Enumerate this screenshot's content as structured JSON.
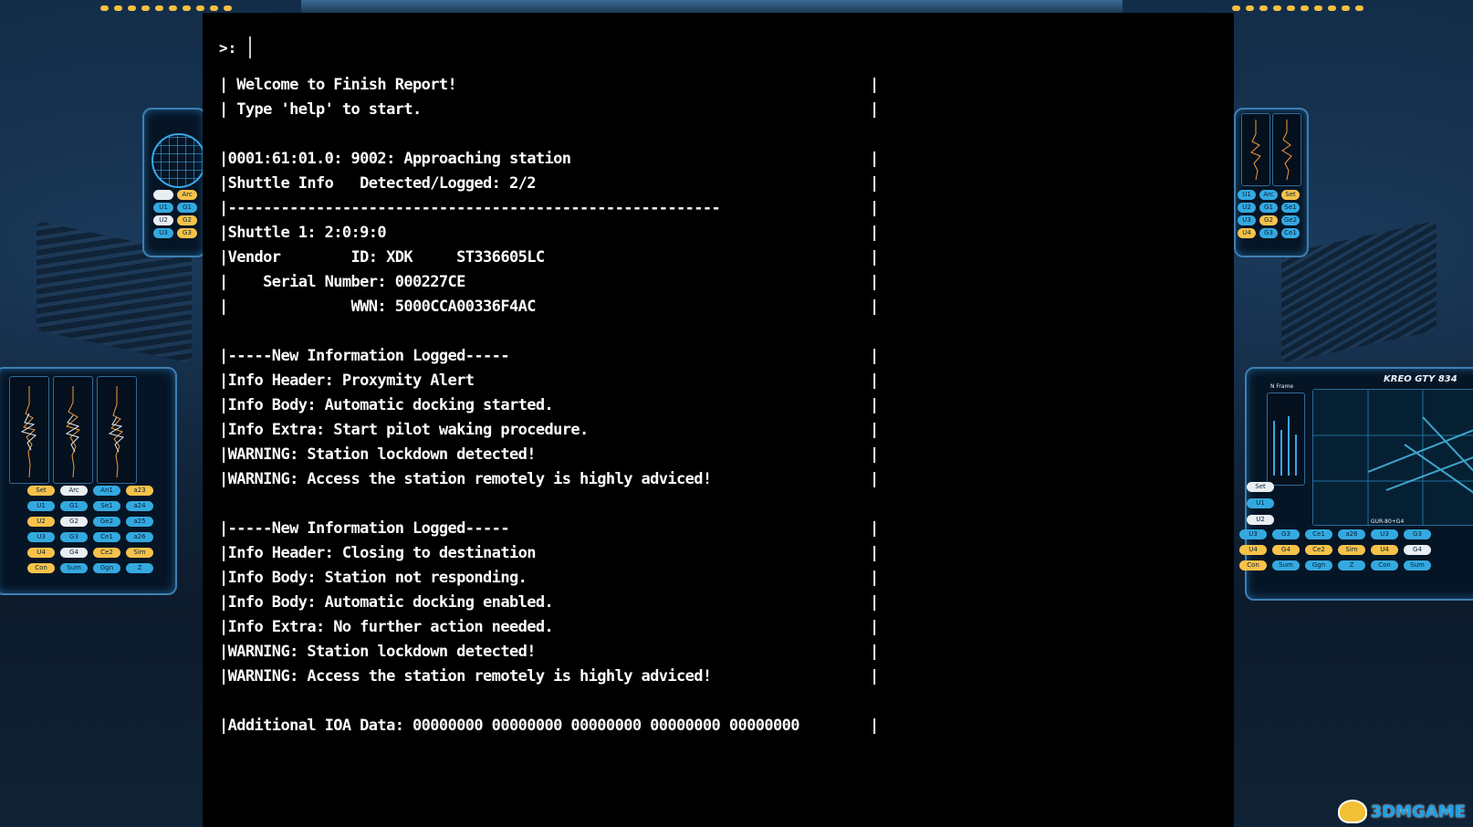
{
  "terminal": {
    "prompt": ">:",
    "lines": [
      {
        "text": "| Welcome to Finish Report!",
        "bar": true
      },
      {
        "text": "| Type 'help' to start.",
        "bar": true
      },
      {
        "text": "",
        "bar": false
      },
      {
        "text": "|0001:61:01.0: 9002: Approaching station",
        "bar": true
      },
      {
        "text": "|Shuttle Info   Detected/Logged: 2/2",
        "bar": true
      },
      {
        "text": "|--------------------------------------------------------",
        "bar": true
      },
      {
        "text": "|Shuttle 1: 2:0:9:0",
        "bar": true
      },
      {
        "text": "|Vendor        ID: XDK     ST336605LC",
        "bar": true
      },
      {
        "text": "|    Serial Number: 000227CE",
        "bar": true
      },
      {
        "text": "|              WWN: 5000CCA00336F4AC",
        "bar": true
      },
      {
        "text": "",
        "bar": false
      },
      {
        "text": "|-----New Information Logged-----",
        "bar": true
      },
      {
        "text": "|Info Header: Proxymity Alert",
        "bar": true
      },
      {
        "text": "|Info Body: Automatic docking started.",
        "bar": true
      },
      {
        "text": "|Info Extra: Start pilot waking procedure.",
        "bar": true
      },
      {
        "text": "|WARNING: Station lockdown detected!",
        "bar": true
      },
      {
        "text": "|WARNING: Access the station remotely is highly adviced!",
        "bar": true
      },
      {
        "text": "",
        "bar": false
      },
      {
        "text": "|-----New Information Logged-----",
        "bar": true
      },
      {
        "text": "|Info Header: Closing to destination",
        "bar": true
      },
      {
        "text": "|Info Body: Station not responding.",
        "bar": true
      },
      {
        "text": "|Info Body: Automatic docking enabled.",
        "bar": true
      },
      {
        "text": "|Info Extra: No further action needed.",
        "bar": true
      },
      {
        "text": "|WARNING: Station lockdown detected!",
        "bar": true
      },
      {
        "text": "|WARNING: Access the station remotely is highly adviced!",
        "bar": true
      },
      {
        "text": "",
        "bar": false
      },
      {
        "text": "|Additional IOA Data: 00000000 00000000 00000000 00000000 00000000",
        "bar": true
      }
    ]
  },
  "left_console": {
    "chips": [
      {
        "label": "Set",
        "color": "y"
      },
      {
        "label": "Arc",
        "color": "w"
      },
      {
        "label": "An1",
        "color": "b"
      },
      {
        "label": "a23",
        "color": "y"
      },
      {
        "label": "U1",
        "color": "b"
      },
      {
        "label": "G1",
        "color": "b"
      },
      {
        "label": "Se1",
        "color": "b"
      },
      {
        "label": "a24",
        "color": "b"
      },
      {
        "label": "U2",
        "color": "y"
      },
      {
        "label": "G2",
        "color": "w"
      },
      {
        "label": "Ge2",
        "color": "b"
      },
      {
        "label": "a25",
        "color": "b"
      },
      {
        "label": "U3",
        "color": "b"
      },
      {
        "label": "G3",
        "color": "b"
      },
      {
        "label": "Ce1",
        "color": "b"
      },
      {
        "label": "a26",
        "color": "b"
      },
      {
        "label": "U4",
        "color": "y"
      },
      {
        "label": "G4",
        "color": "w"
      },
      {
        "label": "Ce2",
        "color": "y"
      },
      {
        "label": "Sim",
        "color": "y"
      },
      {
        "label": "Con",
        "color": "y"
      },
      {
        "label": "Sum",
        "color": "b"
      },
      {
        "label": "Ggn",
        "color": "b"
      },
      {
        "label": "Z",
        "color": "b"
      }
    ],
    "upper_chips": [
      {
        "label": "",
        "color": "w"
      },
      {
        "label": "Arc",
        "color": "y"
      },
      {
        "label": "U1",
        "color": "b"
      },
      {
        "label": "G1",
        "color": "b"
      },
      {
        "label": "U2",
        "color": "w"
      },
      {
        "label": "G2",
        "color": "y"
      },
      {
        "label": "U3",
        "color": "b"
      },
      {
        "label": "G3",
        "color": "y"
      }
    ]
  },
  "right_console": {
    "title": "KREO GTY 834",
    "frame_label": "N Frame",
    "bottom_label": "GUR-80+G4",
    "side_chips": [
      {
        "label": "Set",
        "color": "w"
      },
      {
        "label": "U1",
        "color": "b"
      },
      {
        "label": "U2",
        "color": "w"
      }
    ],
    "chips": [
      {
        "label": "U3",
        "color": "b"
      },
      {
        "label": "G3",
        "color": "b"
      },
      {
        "label": "Ce1",
        "color": "b"
      },
      {
        "label": "a26",
        "color": "b"
      },
      {
        "label": "U3",
        "color": "b"
      },
      {
        "label": "G3",
        "color": "b"
      },
      {
        "label": "U4",
        "color": "y"
      },
      {
        "label": "G4",
        "color": "y"
      },
      {
        "label": "Ce2",
        "color": "y"
      },
      {
        "label": "Sim",
        "color": "y"
      },
      {
        "label": "U4",
        "color": "y"
      },
      {
        "label": "G4",
        "color": "w"
      },
      {
        "label": "Con",
        "color": "y"
      },
      {
        "label": "Sum",
        "color": "b"
      },
      {
        "label": "Ggn",
        "color": "b"
      },
      {
        "label": "Z",
        "color": "b"
      },
      {
        "label": "Con",
        "color": "b"
      },
      {
        "label": "Sum",
        "color": "b"
      }
    ],
    "upper_chips": [
      {
        "label": "U1",
        "color": "b"
      },
      {
        "label": "Arc",
        "color": "b"
      },
      {
        "label": "Set",
        "color": "y"
      },
      {
        "label": "U2",
        "color": "b"
      },
      {
        "label": "G1",
        "color": "b"
      },
      {
        "label": "Se1",
        "color": "b"
      },
      {
        "label": "U3",
        "color": "b"
      },
      {
        "label": "G2",
        "color": "y"
      },
      {
        "label": "Ge2",
        "color": "b"
      },
      {
        "label": "U4",
        "color": "y"
      },
      {
        "label": "G3",
        "color": "b"
      },
      {
        "label": "Ce1",
        "color": "b"
      }
    ]
  },
  "watermark": {
    "text": "3DMGAME"
  },
  "colors": {
    "terminal_bg": "#000000",
    "terminal_text": "#ffffff",
    "accent_blue": "#34a9e0",
    "accent_yellow": "#f7c24a"
  }
}
